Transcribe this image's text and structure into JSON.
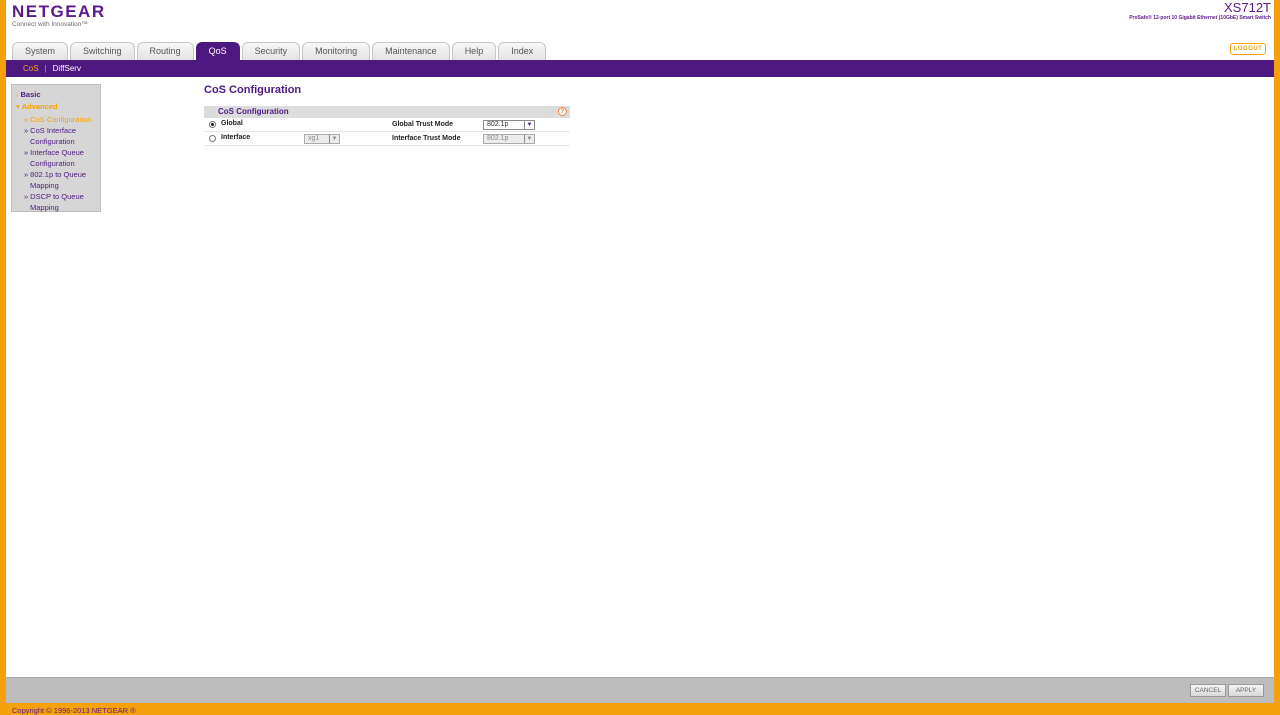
{
  "brand": {
    "logo": "NETGEAR",
    "tagline": "Connect with Innovation™",
    "model": "XS712T",
    "model_desc": "ProSafe® 12-port 10 Gigabit Ethernet (10GbE) Smart Switch",
    "logout_label": "LOGOUT"
  },
  "tabs": [
    {
      "label": "System"
    },
    {
      "label": "Switching"
    },
    {
      "label": "Routing"
    },
    {
      "label": "QoS",
      "active": true
    },
    {
      "label": "Security"
    },
    {
      "label": "Monitoring"
    },
    {
      "label": "Maintenance"
    },
    {
      "label": "Help"
    },
    {
      "label": "Index"
    }
  ],
  "subnav": {
    "current": "CoS",
    "separator": "|",
    "other": "DiffServ"
  },
  "side": {
    "basic": "Basic",
    "advanced": "Advanced",
    "items": [
      {
        "line1": "CoS Configuration",
        "line2": ""
      },
      {
        "line1": "CoS Interface",
        "line2": "Configuration"
      },
      {
        "line1": "Interface Queue",
        "line2": "Configuration"
      },
      {
        "line1": "802.1p to Queue",
        "line2": "Mapping"
      },
      {
        "line1": "DSCP to Queue",
        "line2": "Mapping"
      }
    ]
  },
  "main": {
    "title": "CoS Configuration",
    "section_title": "CoS Configuration",
    "help_icon": "?",
    "rows": [
      {
        "radio_label": "Global",
        "selected": true,
        "field_label": "Global Trust Mode",
        "field_value": "802.1p"
      },
      {
        "radio_label": "Interface",
        "selected": false,
        "interface_value": "xg1",
        "field_label": "Interface Trust Mode",
        "field_value": "802.1p"
      }
    ]
  },
  "footer": {
    "cancel": "CANCEL",
    "apply": "APPLY",
    "copyright": "Copyright © 1996-2013 NETGEAR ®"
  },
  "colors": {
    "accent": "#f5a10b",
    "brand": "#4d1980"
  }
}
